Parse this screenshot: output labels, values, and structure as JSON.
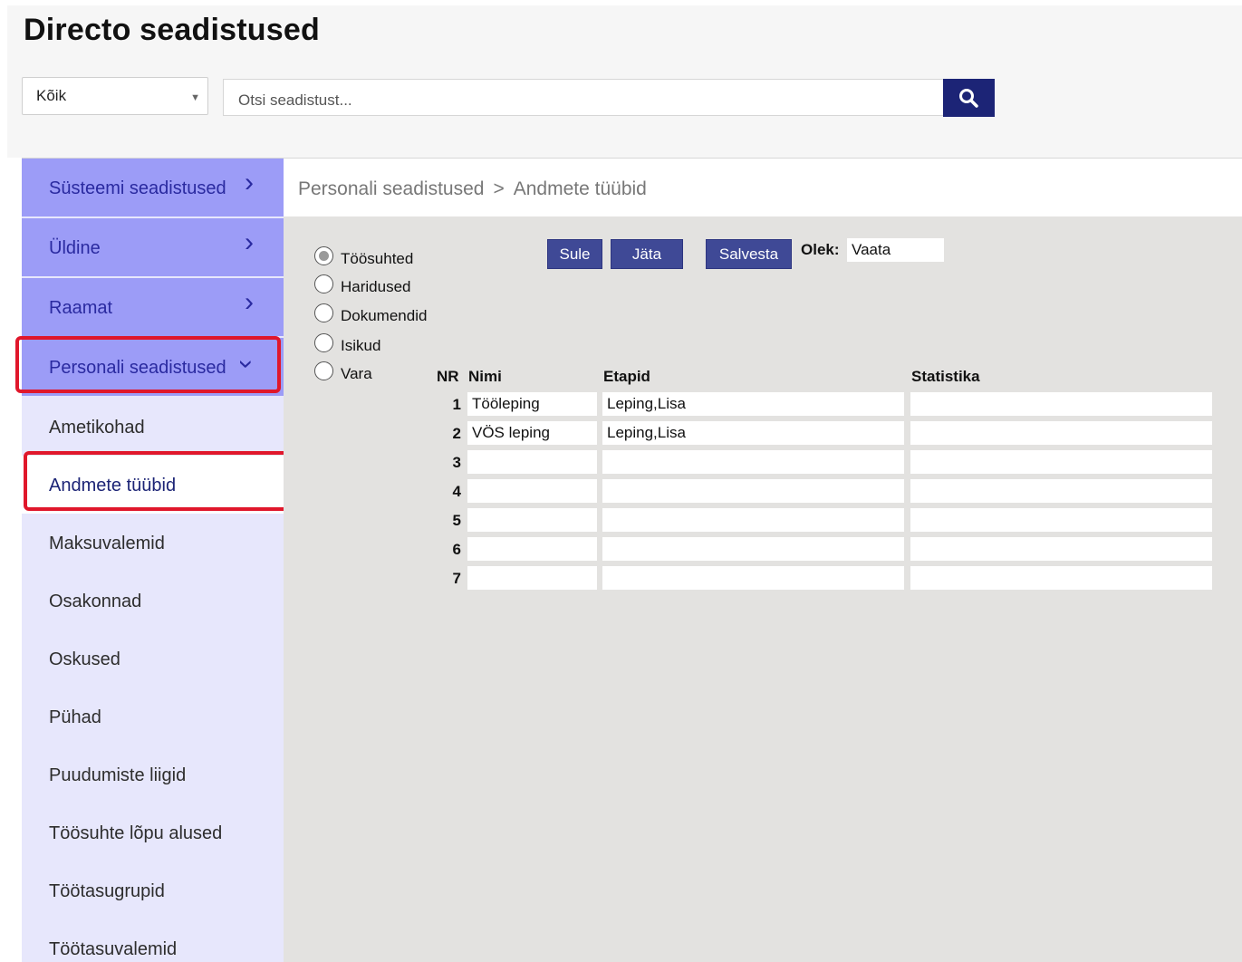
{
  "header": {
    "title": "Directo seadistused",
    "filter": {
      "selected": "Kõik"
    },
    "search": {
      "placeholder": "Otsi seadistust..."
    }
  },
  "sidebar": {
    "groups": [
      {
        "label": "Süsteemi seadistused"
      },
      {
        "label": "Üldine"
      },
      {
        "label": "Raamat"
      },
      {
        "label": "Personali seadistused"
      }
    ],
    "sub_items": [
      {
        "label": "Ametikohad"
      },
      {
        "label": "Andmete tüübid"
      },
      {
        "label": "Maksuvalemid"
      },
      {
        "label": "Osakonnad"
      },
      {
        "label": "Oskused"
      },
      {
        "label": "Pühad"
      },
      {
        "label": "Puudumiste liigid"
      },
      {
        "label": "Töösuhte lõpu alused"
      },
      {
        "label": "Töötasugrupid"
      },
      {
        "label": "Töötasuvalemid"
      }
    ]
  },
  "breadcrumb": {
    "parent": "Personali seadistused",
    "separator": ">",
    "current": "Andmete tüübid"
  },
  "form": {
    "radios": [
      {
        "label": "Töösuhted",
        "checked": true
      },
      {
        "label": "Haridused",
        "checked": false
      },
      {
        "label": "Dokumendid",
        "checked": false
      },
      {
        "label": "Isikud",
        "checked": false
      },
      {
        "label": "Vara",
        "checked": false
      }
    ],
    "buttons": {
      "close": "Sule",
      "skip": "Jäta",
      "save": "Salvesta"
    },
    "status_label": "Olek:",
    "status_value": "Vaata"
  },
  "table": {
    "headers": {
      "nr": "NR",
      "name": "Nimi",
      "stages": "Etapid",
      "stats": "Statistika"
    },
    "rows": [
      {
        "nr": "1",
        "name": "Tööleping",
        "stages": "Leping,Lisa",
        "stats": ""
      },
      {
        "nr": "2",
        "name": "VÖS leping",
        "stages": "Leping,Lisa",
        "stats": ""
      },
      {
        "nr": "3",
        "name": "",
        "stages": "",
        "stats": ""
      },
      {
        "nr": "4",
        "name": "",
        "stages": "",
        "stats": ""
      },
      {
        "nr": "5",
        "name": "",
        "stages": "",
        "stats": ""
      },
      {
        "nr": "6",
        "name": "",
        "stages": "",
        "stats": ""
      },
      {
        "nr": "7",
        "name": "",
        "stages": "",
        "stats": ""
      }
    ]
  },
  "colors": {
    "accent": "#1c2476",
    "nav_group_bg": "#9c9cf7",
    "sidebar_bg": "#e7e7fc",
    "highlight": "#e0172b",
    "button_bg": "#3f4996",
    "content_bg": "#e3e2e0"
  },
  "icons": {
    "search": "search-icon",
    "caret": "caret-down-icon",
    "chevron": "chevron-right-icon"
  }
}
